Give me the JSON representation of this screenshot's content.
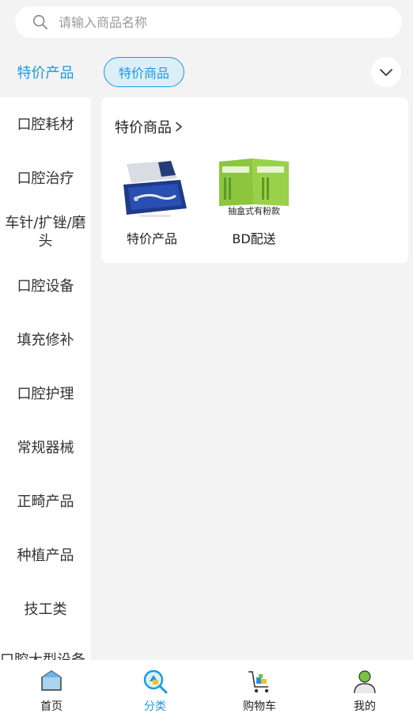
{
  "search": {
    "placeholder": "请输入商品名称"
  },
  "top": {
    "current_category": "特价产品",
    "pill_label": "特价商品"
  },
  "sidebar": {
    "items": [
      {
        "label": "口腔耗材"
      },
      {
        "label": "口腔治疗"
      },
      {
        "label": "车针/扩锉/磨头"
      },
      {
        "label": "口腔设备"
      },
      {
        "label": "填充修补"
      },
      {
        "label": "口腔护理"
      },
      {
        "label": "常规器械"
      },
      {
        "label": "正畸产品"
      },
      {
        "label": "种植产品"
      },
      {
        "label": "技工类"
      },
      {
        "label": "口腔大型设备"
      }
    ]
  },
  "panel": {
    "title": "特价商品",
    "products": [
      {
        "label": "特价产品",
        "image_caption": ""
      },
      {
        "label": "BD配送",
        "image_caption": "抽盒式有粉款"
      }
    ]
  },
  "tabbar": {
    "items": [
      {
        "label": "首页",
        "icon": "home-icon"
      },
      {
        "label": "分类",
        "icon": "category-search-icon"
      },
      {
        "label": "购物车",
        "icon": "cart-icon"
      },
      {
        "label": "我的",
        "icon": "user-icon"
      }
    ],
    "active_index": 1
  },
  "colors": {
    "accent": "#1a9bdc",
    "background": "#f3f3f3"
  }
}
